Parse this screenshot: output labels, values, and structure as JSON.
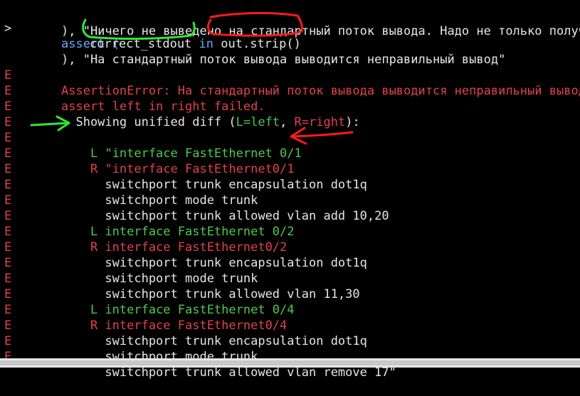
{
  "terminal": {
    "lines": [
      {
        "gutter": "",
        "text": "), \"Ничего не выведено на стандартный поток вывода. Надо не только получ"
      },
      {
        "gutter": ">",
        "text": "assert ("
      },
      {
        "gutter": "",
        "code": [
          "correct_stdout",
          " in ",
          "out.strip()"
        ]
      },
      {
        "gutter": "",
        "text": "), \"На стандартный поток вывода выводится неправильный вывод\""
      },
      {
        "gutter": "E",
        "text": "AssertionError: На стандартный поток вывода выводится неправильный вывод"
      },
      {
        "gutter": "E",
        "text": "assert left in right failed."
      },
      {
        "gutter": "E",
        "diffhead": [
          "  Showing unified diff (",
          "L=left",
          ", ",
          "R=right",
          "):"
        ]
      },
      {
        "gutter": "E",
        "text": ""
      },
      {
        "gutter": "E",
        "text": "    L \"interface FastEthernet 0/1"
      },
      {
        "gutter": "E",
        "text": "    R \"interface FastEthernet0/1"
      },
      {
        "gutter": "E",
        "text": "      switchport trunk encapsulation dot1q"
      },
      {
        "gutter": "E",
        "text": "      switchport mode trunk"
      },
      {
        "gutter": "E",
        "text": "      switchport trunk allowed vlan add 10,20"
      },
      {
        "gutter": "E",
        "text": "    L interface FastEthernet 0/2"
      },
      {
        "gutter": "E",
        "text": "    R interface FastEthernet0/2"
      },
      {
        "gutter": "E",
        "text": "      switchport trunk encapsulation dot1q"
      },
      {
        "gutter": "E",
        "text": "      switchport mode trunk"
      },
      {
        "gutter": "E",
        "text": "      switchport trunk allowed vlan 11,30"
      },
      {
        "gutter": "E",
        "text": "    L interface FastEthernet 0/4"
      },
      {
        "gutter": "E",
        "text": "    R interface FastEthernet0/4"
      },
      {
        "gutter": "E",
        "text": "      switchport trunk encapsulation dot1q"
      },
      {
        "gutter": "E",
        "text": "      switchport mode trunk"
      },
      {
        "gutter": "E",
        "text": "      switchport trunk allowed vlan remove 17\""
      }
    ]
  },
  "colors": {
    "background": "#000000",
    "error_red": "#e0424a",
    "diff_green": "#4ec94e",
    "keyword_blue": "#6aa8ff",
    "annotation_red": "#ff1a1a",
    "annotation_green": "#33e633"
  },
  "annotations": [
    "green-underline",
    "red-underline",
    "green-arrow-icon",
    "red-arrow-icon"
  ]
}
